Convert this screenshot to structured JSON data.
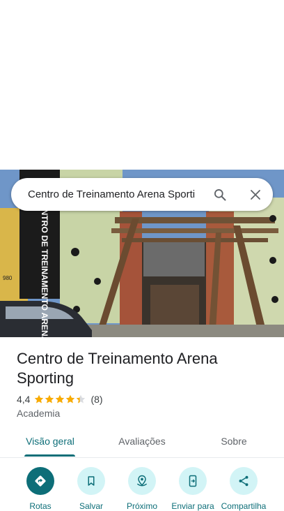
{
  "search": {
    "query": "Centro de Treinamento Arena Sporti"
  },
  "photo": {
    "wall_sign": "CENTRO DE TREINAMENTO ARENA SP",
    "house_number": "980"
  },
  "place": {
    "title": "Centro de Treinamento Arena Sporting",
    "rating": "4,4",
    "stars": 4.4,
    "review_count": "(8)",
    "category": "Academia"
  },
  "tabs": [
    {
      "label": "Visão geral",
      "active": true
    },
    {
      "label": "Avaliações",
      "active": false
    },
    {
      "label": "Sobre",
      "active": false
    }
  ],
  "actions": [
    {
      "label": "Rotas",
      "icon": "directions-icon"
    },
    {
      "label": "Salvar",
      "icon": "bookmark-icon"
    },
    {
      "label": "Próximo",
      "icon": "nearby-icon"
    },
    {
      "label": "Enviar para",
      "icon": "send-to-phone-icon"
    },
    {
      "label": "Compartilha",
      "icon": "share-icon"
    }
  ],
  "colors": {
    "accent": "#0d6e78",
    "accent_light": "#d2f4f6",
    "star": "#f9ab00"
  }
}
